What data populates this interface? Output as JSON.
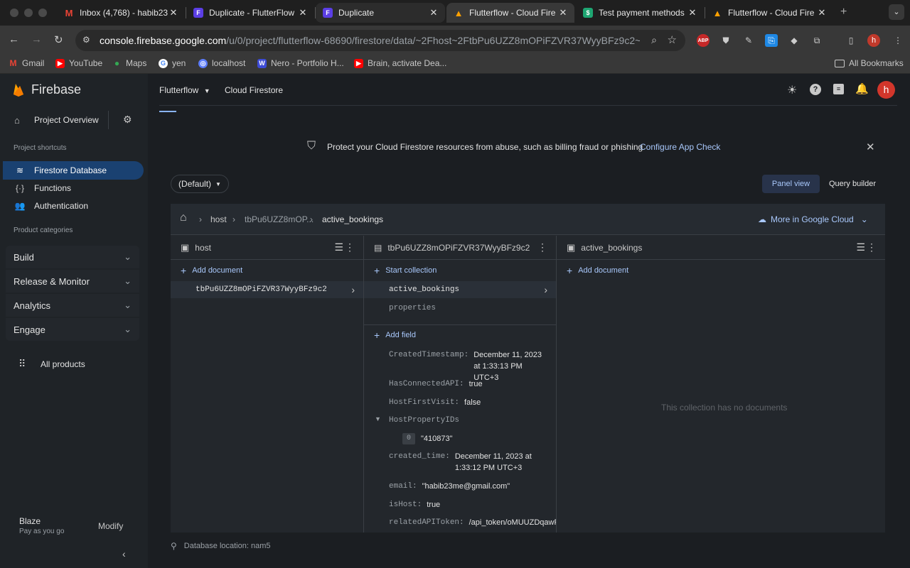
{
  "browser": {
    "tabs": [
      {
        "title": "Inbox (4,768) - habib23",
        "icon": "gmail-icon"
      },
      {
        "title": "Duplicate - FlutterFlow",
        "icon": "flutterflow-icon"
      },
      {
        "title": "Duplicate",
        "icon": "flutterflow-icon"
      },
      {
        "title": "Flutterflow - Cloud Fire",
        "icon": "firebase-icon"
      },
      {
        "title": "Test payment methods",
        "icon": "stripe-icon"
      },
      {
        "title": "Flutterflow - Cloud Fire",
        "icon": "firebase-icon"
      }
    ],
    "url_host": "console.firebase.google.com",
    "url_path": "/u/0/project/flutterflow-68690/firestore/data/~2Fhost~2FtbPu6UZZ8mOPiFZVR37WyyBFz9c2~2Fa...",
    "avatar_letter": "h",
    "bookmarks": [
      "Gmail",
      "YouTube",
      "Maps",
      "yen",
      "localhost",
      "Nero - Portfolio H...",
      "Brain, activate Dea..."
    ],
    "all_bookmarks": "All Bookmarks"
  },
  "sidebar": {
    "brand": "Firebase",
    "project_overview": "Project Overview",
    "shortcuts_label": "Project shortcuts",
    "shortcuts": [
      "Firestore Database",
      "Functions",
      "Authentication"
    ],
    "categories_label": "Product categories",
    "categories": [
      "Build",
      "Release & Monitor",
      "Analytics",
      "Engage"
    ],
    "all_products": "All products",
    "plan_name": "Blaze",
    "plan_desc": "Pay as you go",
    "modify": "Modify"
  },
  "header": {
    "project": "Flutterflow",
    "product": "Cloud Firestore",
    "avatar_letter": "h"
  },
  "banner": {
    "message": "Protect your Cloud Firestore resources from abuse, such as billing fraud or phishing",
    "action": "Configure App Check"
  },
  "toolbar": {
    "database": "(Default)",
    "panel_view": "Panel view",
    "query_builder": "Query builder"
  },
  "path": {
    "crumbs": [
      "host",
      "tbPu6UZZ8mOP...",
      "active_bookings"
    ],
    "more_cloud": "More in Google Cloud"
  },
  "col1": {
    "title": "host",
    "add": "Add document",
    "docs": [
      "tbPu6UZZ8mOPiFZVR37WyyBFz9c2"
    ]
  },
  "col2": {
    "title": "tbPu6UZZ8mOPiFZVR37WyyBFz9c2",
    "start": "Start collection",
    "collections": [
      "active_bookings",
      "properties"
    ],
    "add_field": "Add field",
    "fields": [
      {
        "key": "CreatedTimestamp:",
        "value": "December 11, 2023 at 1:33:13 PM UTC+3"
      },
      {
        "key": "HasConnectedAPI:",
        "value": "true"
      },
      {
        "key": "HostFirstVisit:",
        "value": "false"
      },
      {
        "key": "HostPropertyIDs",
        "value": ""
      },
      {
        "key": "created_time:",
        "value": "December 11, 2023 at 1:33:12 PM UTC+3"
      },
      {
        "key": "email:",
        "value": "\"habib23me@gmail.com\""
      },
      {
        "key": "isHost:",
        "value": "true"
      },
      {
        "key": "relatedAPIToken:",
        "value": "/api_token/oMUUZDqawF"
      }
    ],
    "array_index": "0",
    "array_value": "\"410873\""
  },
  "col3": {
    "title": "active_bookings",
    "add": "Add document",
    "empty": "This collection has no documents"
  },
  "footer": {
    "location": "Database location: nam5"
  }
}
